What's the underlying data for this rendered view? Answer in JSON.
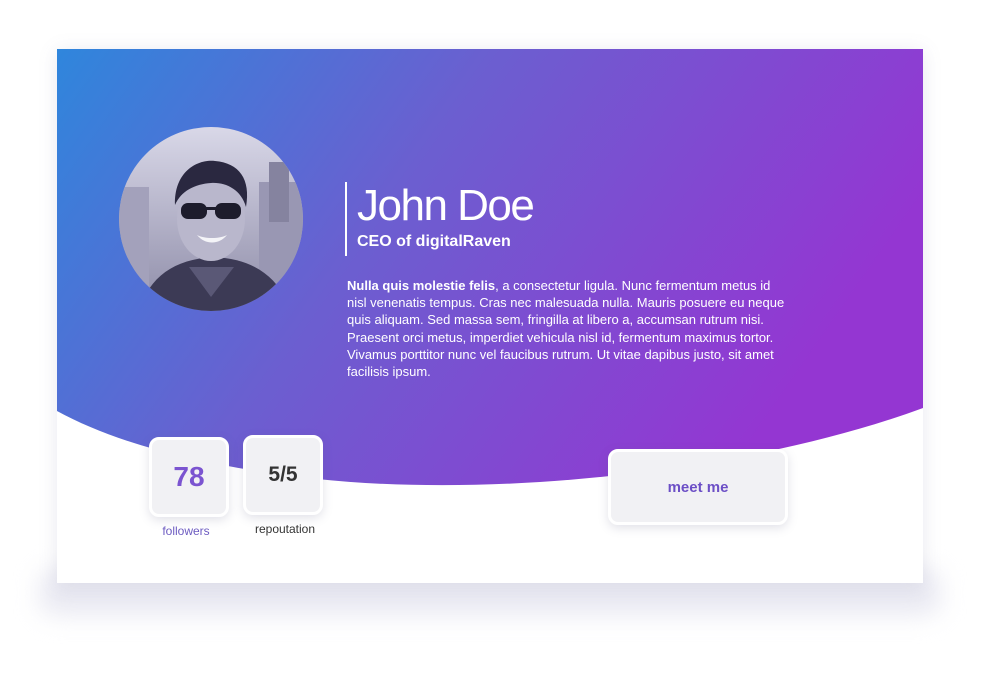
{
  "profile": {
    "name": "John Doe",
    "role": "CEO of digitalRaven",
    "bio_bold": "Nulla quis molestie felis",
    "bio_rest": ", a consectetur ligula. Nunc fermentum metus id nisl venenatis tempus. Cras nec malesuada nulla. Mauris posuere eu neque quis aliquam. Sed massa sem, fringilla at libero a, accumsan rutrum nisi. Praesent orci metus, imperdiet vehicula nisl id, fermentum maximus tortor. Vivamus porttitor nunc vel faucibus rutrum. Ut vitae dapibus justo, sit amet facilisis ipsum."
  },
  "stats": {
    "followers_value": "78",
    "followers_label": "followers",
    "reputation_value": "5/5",
    "reputation_label": "repoutation"
  },
  "actions": {
    "meet_label": "meet me"
  },
  "colors": {
    "gradient_start": "#2f86dc",
    "gradient_end": "#9436d2",
    "accent": "#7b54d0"
  }
}
